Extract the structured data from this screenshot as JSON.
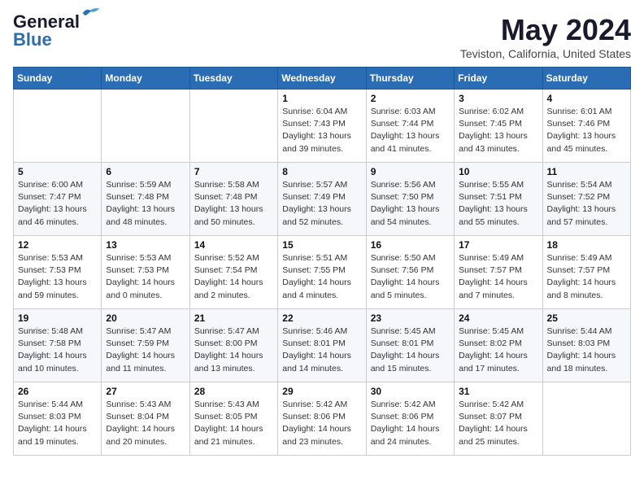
{
  "app": {
    "name_general": "General",
    "name_blue": "Blue",
    "title": "May 2024",
    "location": "Teviston, California, United States"
  },
  "days_of_week": [
    "Sunday",
    "Monday",
    "Tuesday",
    "Wednesday",
    "Thursday",
    "Friday",
    "Saturday"
  ],
  "weeks": [
    {
      "days": [
        {
          "num": "",
          "sunrise": "",
          "sunset": "",
          "daylight": ""
        },
        {
          "num": "",
          "sunrise": "",
          "sunset": "",
          "daylight": ""
        },
        {
          "num": "",
          "sunrise": "",
          "sunset": "",
          "daylight": ""
        },
        {
          "num": "1",
          "sunrise": "Sunrise: 6:04 AM",
          "sunset": "Sunset: 7:43 PM",
          "daylight": "Daylight: 13 hours and 39 minutes."
        },
        {
          "num": "2",
          "sunrise": "Sunrise: 6:03 AM",
          "sunset": "Sunset: 7:44 PM",
          "daylight": "Daylight: 13 hours and 41 minutes."
        },
        {
          "num": "3",
          "sunrise": "Sunrise: 6:02 AM",
          "sunset": "Sunset: 7:45 PM",
          "daylight": "Daylight: 13 hours and 43 minutes."
        },
        {
          "num": "4",
          "sunrise": "Sunrise: 6:01 AM",
          "sunset": "Sunset: 7:46 PM",
          "daylight": "Daylight: 13 hours and 45 minutes."
        }
      ]
    },
    {
      "days": [
        {
          "num": "5",
          "sunrise": "Sunrise: 6:00 AM",
          "sunset": "Sunset: 7:47 PM",
          "daylight": "Daylight: 13 hours and 46 minutes."
        },
        {
          "num": "6",
          "sunrise": "Sunrise: 5:59 AM",
          "sunset": "Sunset: 7:48 PM",
          "daylight": "Daylight: 13 hours and 48 minutes."
        },
        {
          "num": "7",
          "sunrise": "Sunrise: 5:58 AM",
          "sunset": "Sunset: 7:48 PM",
          "daylight": "Daylight: 13 hours and 50 minutes."
        },
        {
          "num": "8",
          "sunrise": "Sunrise: 5:57 AM",
          "sunset": "Sunset: 7:49 PM",
          "daylight": "Daylight: 13 hours and 52 minutes."
        },
        {
          "num": "9",
          "sunrise": "Sunrise: 5:56 AM",
          "sunset": "Sunset: 7:50 PM",
          "daylight": "Daylight: 13 hours and 54 minutes."
        },
        {
          "num": "10",
          "sunrise": "Sunrise: 5:55 AM",
          "sunset": "Sunset: 7:51 PM",
          "daylight": "Daylight: 13 hours and 55 minutes."
        },
        {
          "num": "11",
          "sunrise": "Sunrise: 5:54 AM",
          "sunset": "Sunset: 7:52 PM",
          "daylight": "Daylight: 13 hours and 57 minutes."
        }
      ]
    },
    {
      "days": [
        {
          "num": "12",
          "sunrise": "Sunrise: 5:53 AM",
          "sunset": "Sunset: 7:53 PM",
          "daylight": "Daylight: 13 hours and 59 minutes."
        },
        {
          "num": "13",
          "sunrise": "Sunrise: 5:53 AM",
          "sunset": "Sunset: 7:53 PM",
          "daylight": "Daylight: 14 hours and 0 minutes."
        },
        {
          "num": "14",
          "sunrise": "Sunrise: 5:52 AM",
          "sunset": "Sunset: 7:54 PM",
          "daylight": "Daylight: 14 hours and 2 minutes."
        },
        {
          "num": "15",
          "sunrise": "Sunrise: 5:51 AM",
          "sunset": "Sunset: 7:55 PM",
          "daylight": "Daylight: 14 hours and 4 minutes."
        },
        {
          "num": "16",
          "sunrise": "Sunrise: 5:50 AM",
          "sunset": "Sunset: 7:56 PM",
          "daylight": "Daylight: 14 hours and 5 minutes."
        },
        {
          "num": "17",
          "sunrise": "Sunrise: 5:49 AM",
          "sunset": "Sunset: 7:57 PM",
          "daylight": "Daylight: 14 hours and 7 minutes."
        },
        {
          "num": "18",
          "sunrise": "Sunrise: 5:49 AM",
          "sunset": "Sunset: 7:57 PM",
          "daylight": "Daylight: 14 hours and 8 minutes."
        }
      ]
    },
    {
      "days": [
        {
          "num": "19",
          "sunrise": "Sunrise: 5:48 AM",
          "sunset": "Sunset: 7:58 PM",
          "daylight": "Daylight: 14 hours and 10 minutes."
        },
        {
          "num": "20",
          "sunrise": "Sunrise: 5:47 AM",
          "sunset": "Sunset: 7:59 PM",
          "daylight": "Daylight: 14 hours and 11 minutes."
        },
        {
          "num": "21",
          "sunrise": "Sunrise: 5:47 AM",
          "sunset": "Sunset: 8:00 PM",
          "daylight": "Daylight: 14 hours and 13 minutes."
        },
        {
          "num": "22",
          "sunrise": "Sunrise: 5:46 AM",
          "sunset": "Sunset: 8:01 PM",
          "daylight": "Daylight: 14 hours and 14 minutes."
        },
        {
          "num": "23",
          "sunrise": "Sunrise: 5:45 AM",
          "sunset": "Sunset: 8:01 PM",
          "daylight": "Daylight: 14 hours and 15 minutes."
        },
        {
          "num": "24",
          "sunrise": "Sunrise: 5:45 AM",
          "sunset": "Sunset: 8:02 PM",
          "daylight": "Daylight: 14 hours and 17 minutes."
        },
        {
          "num": "25",
          "sunrise": "Sunrise: 5:44 AM",
          "sunset": "Sunset: 8:03 PM",
          "daylight": "Daylight: 14 hours and 18 minutes."
        }
      ]
    },
    {
      "days": [
        {
          "num": "26",
          "sunrise": "Sunrise: 5:44 AM",
          "sunset": "Sunset: 8:03 PM",
          "daylight": "Daylight: 14 hours and 19 minutes."
        },
        {
          "num": "27",
          "sunrise": "Sunrise: 5:43 AM",
          "sunset": "Sunset: 8:04 PM",
          "daylight": "Daylight: 14 hours and 20 minutes."
        },
        {
          "num": "28",
          "sunrise": "Sunrise: 5:43 AM",
          "sunset": "Sunset: 8:05 PM",
          "daylight": "Daylight: 14 hours and 21 minutes."
        },
        {
          "num": "29",
          "sunrise": "Sunrise: 5:42 AM",
          "sunset": "Sunset: 8:06 PM",
          "daylight": "Daylight: 14 hours and 23 minutes."
        },
        {
          "num": "30",
          "sunrise": "Sunrise: 5:42 AM",
          "sunset": "Sunset: 8:06 PM",
          "daylight": "Daylight: 14 hours and 24 minutes."
        },
        {
          "num": "31",
          "sunrise": "Sunrise: 5:42 AM",
          "sunset": "Sunset: 8:07 PM",
          "daylight": "Daylight: 14 hours and 25 minutes."
        },
        {
          "num": "",
          "sunrise": "",
          "sunset": "",
          "daylight": ""
        }
      ]
    }
  ]
}
